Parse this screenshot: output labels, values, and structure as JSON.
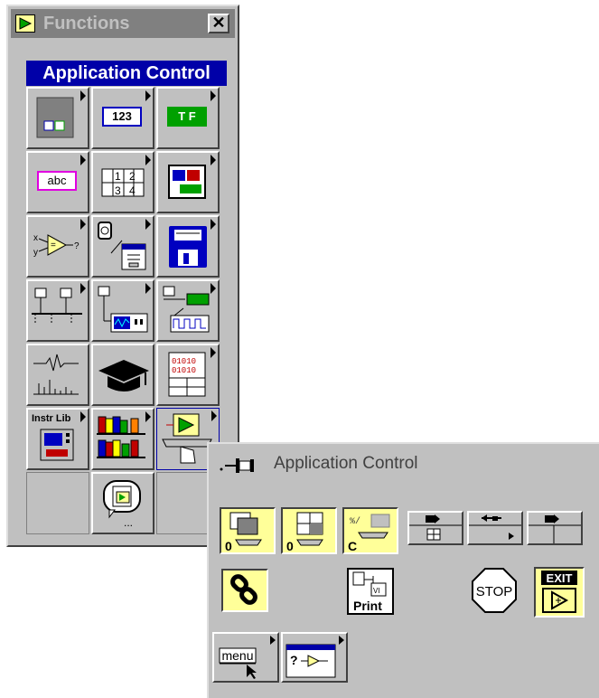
{
  "functions_palette": {
    "title": "Functions",
    "close_glyph": "✕",
    "subpalette_title": "Application Control",
    "cells": [
      {
        "name": "structures-icon"
      },
      {
        "name": "numeric-icon",
        "label": "123"
      },
      {
        "name": "boolean-icon",
        "label": "T F"
      },
      {
        "name": "string-icon",
        "label": "abc"
      },
      {
        "name": "array-icon",
        "label": "1 2 3 4"
      },
      {
        "name": "cluster-icon"
      },
      {
        "name": "comparison-icon"
      },
      {
        "name": "time-dialog-icon"
      },
      {
        "name": "file-io-icon"
      },
      {
        "name": "communication-icon"
      },
      {
        "name": "instrument-io-icon"
      },
      {
        "name": "data-acquisition-icon"
      },
      {
        "name": "analysis-icon"
      },
      {
        "name": "tutorial-icon"
      },
      {
        "name": "advanced-icon"
      },
      {
        "name": "instrument-library-icon",
        "label": "Instr Lib"
      },
      {
        "name": "user-libraries-icon"
      },
      {
        "name": "application-control-icon"
      },
      {
        "name": "select-vi-icon"
      }
    ]
  },
  "application_control_palette": {
    "title": "Application Control",
    "items": [
      {
        "name": "open-vi-reference-icon",
        "label": "0"
      },
      {
        "name": "open-panel-reference-icon",
        "label": "0"
      },
      {
        "name": "close-reference-icon",
        "label": "C"
      },
      {
        "name": "property-node-icon"
      },
      {
        "name": "invoke-node-icon"
      },
      {
        "name": "call-by-reference-icon"
      },
      {
        "name": "link-icon"
      },
      {
        "name": "print-panel-icon",
        "label": "Print"
      },
      {
        "name": "stop-icon",
        "label": "STOP"
      },
      {
        "name": "exit-labview-icon",
        "label": "EXIT"
      },
      {
        "name": "menu-icon",
        "label": "menu"
      },
      {
        "name": "help-icon",
        "label": "?"
      }
    ]
  }
}
